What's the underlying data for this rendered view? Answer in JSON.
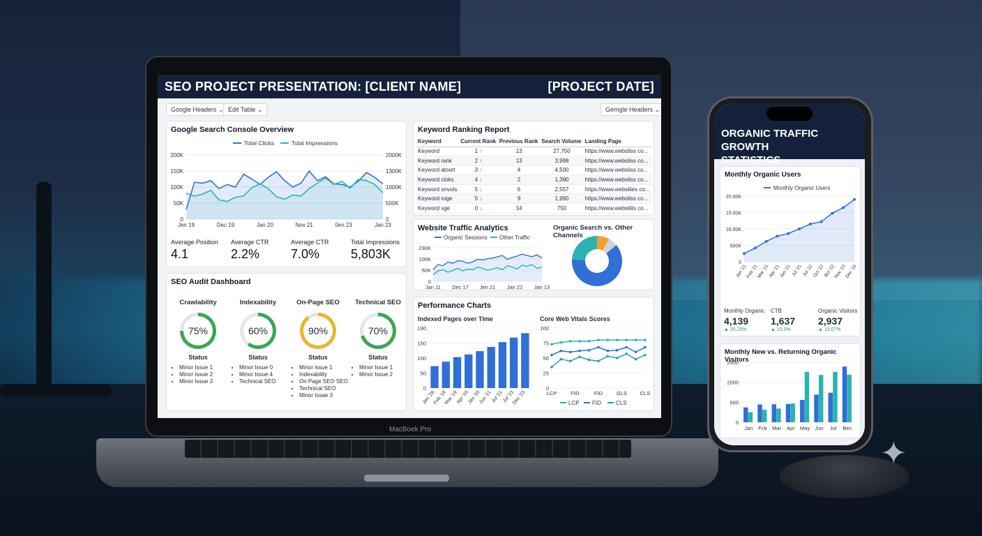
{
  "presentation": {
    "title": "SEO PROJECT PRESENTATION: [CLIENT NAME]",
    "date": "[PROJECT DATE]"
  },
  "toolbar": {
    "google_headers": "Google Headers",
    "edit_table": "Edit Table",
    "gemgle_headers": "Gemgle Headers"
  },
  "device": {
    "brand": "MacBoek Pro"
  },
  "gsc": {
    "title": "Google Search Console Overview",
    "metrics": [
      {
        "label": "Average Position",
        "value": "4.1"
      },
      {
        "label": "Average CTR",
        "value": "2.2%"
      },
      {
        "label": "Average CTR",
        "value": "7.0%"
      },
      {
        "label": "Total Impressions",
        "value": "5,803K"
      }
    ]
  },
  "keywords": {
    "title": "Keyword Ranking Report",
    "columns": [
      "Keyword",
      "Current Rank",
      "Previous Rank",
      "Search Volume",
      "Landing Page"
    ],
    "rows": [
      {
        "keyword": "Keyword",
        "current": "1",
        "trend": "up",
        "previous": "13",
        "volume": "27,750",
        "page": "https://www.websliss co..."
      },
      {
        "keyword": "Keyword rank",
        "current": "2",
        "trend": "up",
        "previous": "13",
        "volume": "3,998",
        "page": "https://www.websliss co..."
      },
      {
        "keyword": "Keyword atoort",
        "current": "3",
        "trend": "up",
        "previous": "4",
        "volume": "4,500",
        "page": "https://www.websliss co..."
      },
      {
        "keyword": "Keyword cloks",
        "current": "4",
        "trend": "down",
        "previous": "2",
        "volume": "1,390",
        "page": "https://www.websliss co..."
      },
      {
        "keyword": "Keyword snvots",
        "current": "5",
        "trend": "down",
        "previous": "6",
        "volume": "2,557",
        "page": "https://www.websliies co..."
      },
      {
        "keyword": "Keyword roge",
        "current": "5",
        "trend": "down",
        "previous": "9",
        "volume": "1,990",
        "page": "https://www.websliss co..."
      },
      {
        "keyword": "Keyword sge",
        "current": "0",
        "trend": "down",
        "previous": "14",
        "volume": "750",
        "page": "https://www.websliits co..."
      }
    ]
  },
  "traffic": {
    "title": "Website Traffic Analytics"
  },
  "channels": {
    "title": "Organic Search vs. Other Channels"
  },
  "audit": {
    "title": "SEO Audit Dashboard",
    "status_label": "Status",
    "items": [
      {
        "name": "Crawlability",
        "percent": "75%",
        "color": "#3aa657",
        "fill": 0.75,
        "issues": [
          "Minor Issue 1",
          "Minor Issue 2",
          "Minor Issue 3"
        ]
      },
      {
        "name": "Indexability",
        "percent": "60%",
        "color": "#3aa657",
        "fill": 0.6,
        "issues": [
          "Minor Issue 0",
          "Minor Issue 4",
          "Technical SEO"
        ]
      },
      {
        "name": "On-Page SEO",
        "percent": "90%",
        "color": "#e8b530",
        "fill": 0.9,
        "issues": [
          "Minor issue 1",
          "Indexability",
          "On Page SEO SEO",
          "Technical SEO",
          "Minor Issae 3"
        ]
      },
      {
        "name": "Technical SEO",
        "percent": "70%",
        "color": "#3aa657",
        "fill": 0.7,
        "issues": [
          "Minor Issue 1",
          "Minor Issue 2"
        ]
      }
    ]
  },
  "performance": {
    "title": "Performance Charts"
  },
  "phone": {
    "title_line1": "ORGANIC TRAFFIC GROWTH",
    "title_line2": "STATISTICS",
    "monthly_users_title": "Monthly Organic Users",
    "stats": [
      {
        "label": "Monthly Organic",
        "value": "4,139",
        "delta": "▲ 35.25%"
      },
      {
        "label": "CTB",
        "value": "1,637",
        "delta": "▲ 15.0%"
      },
      {
        "label": "Organic Visitors",
        "value": "2,937",
        "delta": "▲ 15.07%"
      }
    ],
    "new_vs_returning_title": "Monthly New vs. Returning Organic Visitors"
  },
  "chart_data": [
    {
      "type": "area",
      "id": "gsc",
      "series": [
        {
          "name": "Total Clicks",
          "color": "#2f6fd6",
          "values": [
            30,
            115,
            112,
            120,
            95,
            108,
            100,
            140,
            125,
            108,
            130,
            148,
            120,
            100,
            112,
            150,
            120,
            132,
            110,
            108,
            100,
            118,
            145,
            130,
            110
          ]
        },
        {
          "name": "Total Impressions",
          "color": "#2bb3b1",
          "values": [
            80,
            72,
            78,
            90,
            60,
            55,
            68,
            72,
            98,
            110,
            95,
            70,
            62,
            75,
            72,
            95,
            112,
            128,
            108,
            118,
            96,
            124,
            120,
            108,
            82
          ]
        }
      ],
      "x_ticks": [
        "Jen 19",
        "Dec 19",
        "Jan 20",
        "Nov 21",
        "0en 23",
        "Jan 23"
      ],
      "y_left_ticks": [
        "200K",
        "150K",
        "100K",
        "50K",
        "0"
      ],
      "y_right_ticks": [
        "2000K",
        "1300K",
        "1000K",
        "500K",
        "0"
      ],
      "ylim": [
        0,
        200
      ]
    },
    {
      "type": "line",
      "id": "traffic",
      "series": [
        {
          "name": "Organic Sessions",
          "color": "#2f6fd6",
          "values": [
            90,
            130,
            120,
            150,
            140,
            160,
            155,
            140,
            150,
            170,
            165,
            175,
            180,
            190,
            200,
            170,
            185,
            195,
            210,
            200,
            190,
            205,
            180
          ]
        },
        {
          "name": "Other Traffic",
          "color": "#2bb3b1",
          "values": [
            50,
            80,
            90,
            70,
            85,
            100,
            80,
            95,
            90,
            110,
            100,
            85,
            95,
            105,
            90,
            120,
            110,
            95,
            125,
            115,
            130,
            100,
            110
          ]
        }
      ],
      "x_ticks": [
        "Jan 11",
        "Dec 17",
        "Jen 21",
        "Jan 22",
        "Jan 13"
      ],
      "y_ticks": [
        "230K",
        "100K",
        "50K",
        "0"
      ],
      "ylim": [
        0,
        260
      ]
    },
    {
      "type": "pie",
      "id": "channels",
      "slices": [
        {
          "label": "Organic Search",
          "value": 62,
          "color": "#2f6fd6"
        },
        {
          "label": "Teal",
          "value": 24,
          "color": "#2bb3b1"
        },
        {
          "label": "Orange",
          "value": 8,
          "color": "#f0a030"
        },
        {
          "label": "Gray",
          "value": 6,
          "color": "#cfd4db"
        }
      ]
    },
    {
      "type": "bar",
      "id": "indexed",
      "title": "Indexed Pages over Time",
      "categories": [
        "Jen '28",
        "Feb '19",
        "Mar '19",
        "Apr '20",
        "Jan '20",
        "Jun '21",
        "Jul '21",
        "Jul '23",
        "Dec '23"
      ],
      "values": [
        73,
        88,
        103,
        112,
        123,
        137,
        153,
        168,
        183
      ],
      "y_ticks": [
        "190",
        "150",
        "100",
        "50",
        "0"
      ],
      "ylim": [
        0,
        200
      ],
      "color": "#2f6fd6"
    },
    {
      "type": "line",
      "id": "cwv",
      "title": "Core Web Vitals Scores",
      "categories": [
        "LCP",
        "FID",
        "FID",
        "GLS",
        "CLS"
      ],
      "series": [
        {
          "name": "LCP",
          "color": "#2bb3b1",
          "values": [
            73,
            76,
            78,
            78,
            78,
            80,
            80,
            80,
            80,
            80,
            80
          ]
        },
        {
          "name": "FID",
          "color": "#2f6fd6",
          "values": [
            55,
            62,
            60,
            62,
            63,
            68,
            62,
            63,
            68,
            60,
            68
          ]
        },
        {
          "name": "CLS",
          "color": "#25a0b8",
          "values": [
            35,
            48,
            45,
            52,
            47,
            45,
            53,
            50,
            57,
            48,
            55
          ]
        }
      ],
      "y_ticks": [
        "100",
        "75",
        "50",
        "25",
        "0"
      ],
      "ylim": [
        0,
        100
      ]
    },
    {
      "type": "line",
      "id": "phone-users",
      "title": "Monthly Organic Users",
      "series": [
        {
          "name": "Monthly Organic Users",
          "color": "#2f6fd6",
          "values": [
            2.5,
            4.2,
            6.2,
            7.8,
            8.6,
            10.0,
            11.5,
            12.2,
            14.8,
            16.5,
            19.0
          ]
        }
      ],
      "categories": [
        "Jan '21",
        "Feb '21",
        "Mar '21",
        "Apr '21",
        "Jan '21",
        "Jul '21",
        "Jul '22",
        "Oct '22",
        "Bct '22",
        "Nov '23",
        "Dec '23"
      ],
      "y_ticks": [
        "20.00K",
        "15.00K",
        "16.00K",
        "500K",
        "0"
      ],
      "ylim": [
        0,
        20
      ]
    },
    {
      "type": "bar",
      "id": "phone-visitors",
      "title": "Monthly New vs. Returning Organic Visitors",
      "categories": [
        "Jan",
        "Fcb",
        "Mar",
        "Apr",
        "May",
        "Jun",
        "Jul",
        "Bec"
      ],
      "series": [
        {
          "color": "#2f6fd6",
          "values": [
            620,
            740,
            750,
            760,
            930,
            1150,
            1230,
            2320
          ]
        },
        {
          "color": "#2bb3b1",
          "values": [
            420,
            520,
            570,
            780,
            2100,
            1970,
            2100,
            1980
          ]
        }
      ],
      "y_ticks": [
        "2500",
        "2000",
        "500",
        "0"
      ],
      "ylim": [
        0,
        2500
      ]
    }
  ]
}
